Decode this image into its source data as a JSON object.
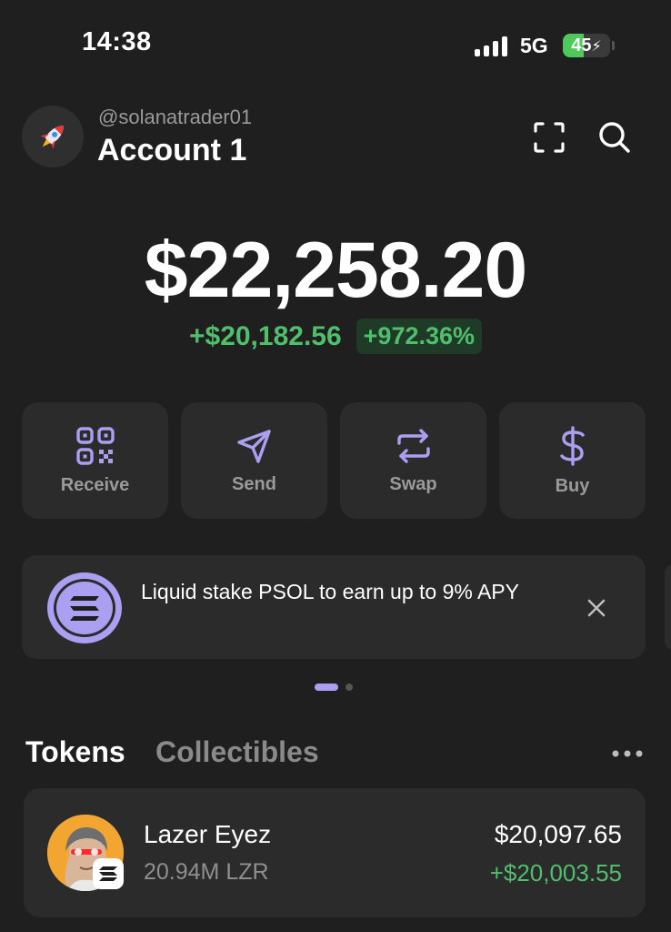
{
  "status_bar": {
    "time": "14:38",
    "network": "5G",
    "battery": "45",
    "battery_level_percent": 45,
    "signal_bars": 4
  },
  "header": {
    "username": "@solanatrader01",
    "account_name": "Account 1",
    "avatar_icon": "rocket-icon",
    "scan_icon": "scan-icon",
    "search_icon": "search-icon"
  },
  "balance": {
    "total": "$22,258.20",
    "change_amount": "+$20,182.56",
    "change_percent": "+972.36%"
  },
  "actions": [
    {
      "label": "Receive",
      "icon": "qr-code-icon"
    },
    {
      "label": "Send",
      "icon": "send-icon"
    },
    {
      "label": "Swap",
      "icon": "swap-icon"
    },
    {
      "label": "Buy",
      "icon": "dollar-icon"
    }
  ],
  "promo": {
    "text": "Liquid stake PSOL to earn up to 9% APY",
    "icon": "solana-logo-icon",
    "close_icon": "close-icon",
    "pages": 2,
    "active_page": 1
  },
  "tabs": [
    {
      "label": "Tokens",
      "active": true
    },
    {
      "label": "Collectibles",
      "active": false
    }
  ],
  "tokens": [
    {
      "name": "Lazer Eyez",
      "amount": "20.94M LZR",
      "value": "$20,097.65",
      "change": "+$20,003.55",
      "chain_icon": "solana-chain-badge-icon"
    }
  ],
  "colors": {
    "background": "#1f1f1f",
    "card": "#2b2b2b",
    "accent": "#ab9ff2",
    "positive": "#4fbf6c",
    "muted_text": "#9a9a9a"
  }
}
